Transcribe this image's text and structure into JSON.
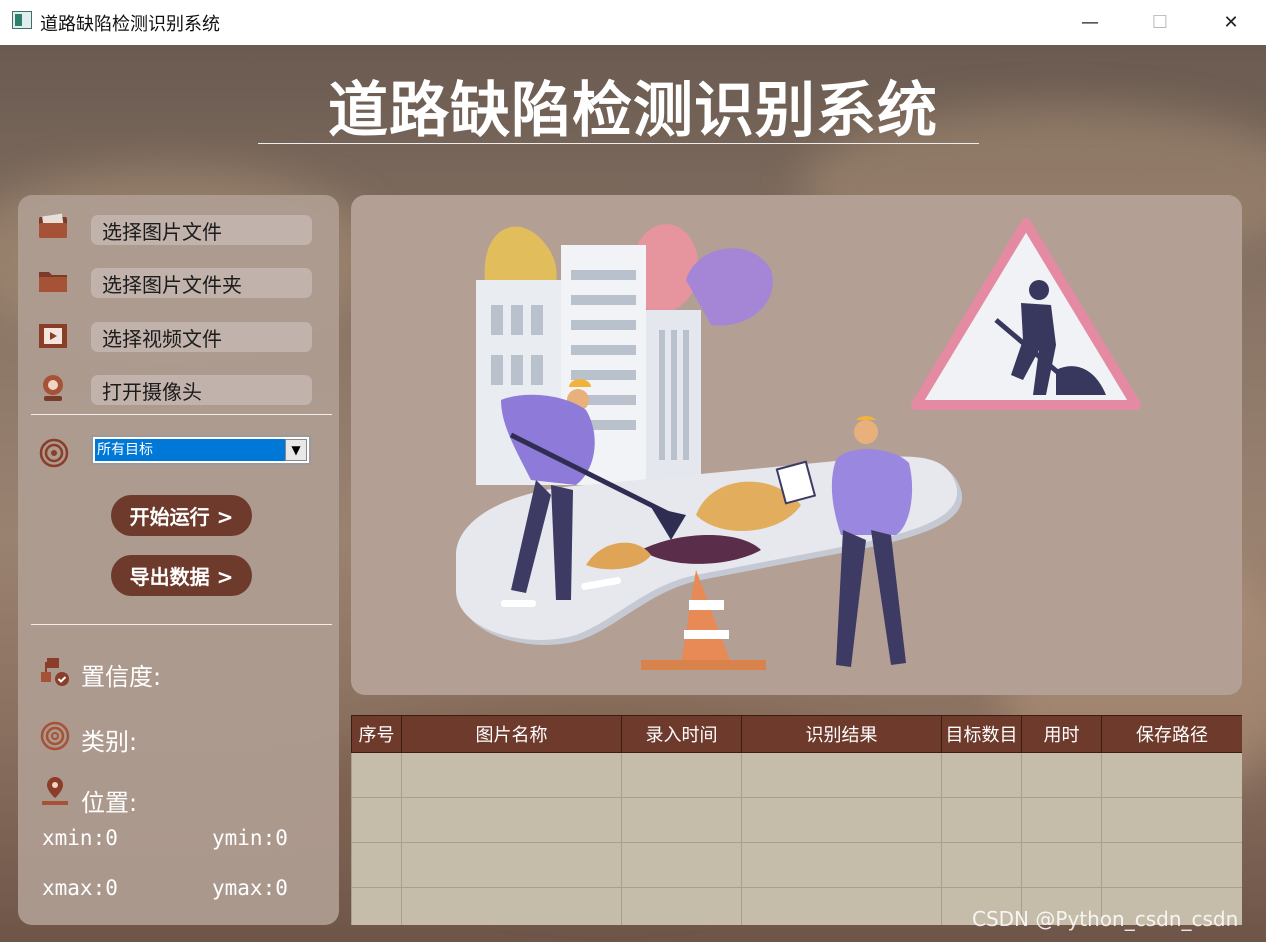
{
  "window": {
    "title": "道路缺陷检测识别系统",
    "minimize": "—",
    "maximize": "☐",
    "close": "✕"
  },
  "header": {
    "title": "道路缺陷检测识别系统"
  },
  "sidebar": {
    "buttons": [
      {
        "label": "选择图片文件",
        "icon": "image-folder-icon"
      },
      {
        "label": "选择图片文件夹",
        "icon": "folder-icon"
      },
      {
        "label": "选择视频文件",
        "icon": "video-icon"
      },
      {
        "label": "打开摄像头",
        "icon": "webcam-icon"
      }
    ],
    "target_select": {
      "value": "所有目标",
      "arrow": "▼",
      "icon": "target-icon"
    },
    "run_label": "开始运行 >",
    "export_label": "导出数据 >",
    "confidence_label": "置信度:",
    "class_label": "类别:",
    "position_label": "位置:",
    "xmin": "xmin:0",
    "ymin": "ymin:0",
    "xmax": "xmax:0",
    "ymax": "ymax:0"
  },
  "table": {
    "headers": [
      "序号",
      "图片名称",
      "录入时间",
      "识别结果",
      "目标数目",
      "用时",
      "保存路径"
    ],
    "rows": 4
  },
  "watermark": "CSDN @Python_csdn_csdn",
  "colors": {
    "accent": "#6e3a2c",
    "panel": "#b39f94",
    "table_bg": "#c6bcaa",
    "selection": "#0078d7"
  }
}
